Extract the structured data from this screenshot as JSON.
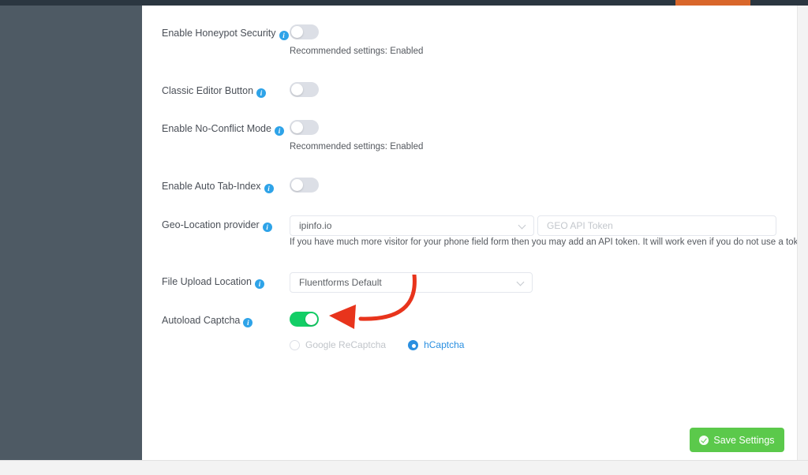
{
  "window": {
    "topbar_accent_color": "#d9672b",
    "sidebar_color": "#4e5a64",
    "accent_blue": "#2a8fe0",
    "toggle_on_color": "#13ce66",
    "save_button_color": "#5bc94b"
  },
  "settings": {
    "rows": [
      {
        "id": "honeypot-security",
        "label": "Enable Honeypot Security",
        "control": "toggle",
        "value": "off",
        "hint": "Recommended settings: Enabled"
      },
      {
        "id": "classic-editor-button",
        "label": "Classic Editor Button",
        "control": "toggle",
        "value": "off",
        "hint": ""
      },
      {
        "id": "no-conflict-mode",
        "label": "Enable No-Conflict Mode",
        "control": "toggle",
        "value": "off",
        "hint": "Recommended settings: Enabled"
      },
      {
        "id": "auto-tab-index",
        "label": "Enable Auto Tab-Index",
        "control": "toggle",
        "value": "off",
        "hint": ""
      },
      {
        "id": "geo-location-provider",
        "label": "Geo-Location provider",
        "control": "select-with-token",
        "select_value": "ipinfo.io",
        "token_placeholder": "GEO API Token",
        "token_value": "",
        "hint": "If you have much more visitor for your phone field form then you may add an API token. It will work even if you do not use a token"
      },
      {
        "id": "file-upload-location",
        "label": "File Upload Location",
        "control": "select",
        "select_value": "Fluentforms Default",
        "hint": ""
      },
      {
        "id": "autoload-captcha",
        "label": "Autoload Captcha",
        "control": "toggle",
        "value": "on",
        "hint": ""
      }
    ],
    "captcha_options": [
      {
        "id": "google-recaptcha",
        "label": "Google ReCaptcha",
        "selected": false
      },
      {
        "id": "hcaptcha",
        "label": "hCaptcha",
        "selected": true
      }
    ],
    "info_icon_glyph": "i"
  },
  "footer": {
    "save_label": "Save Settings"
  }
}
